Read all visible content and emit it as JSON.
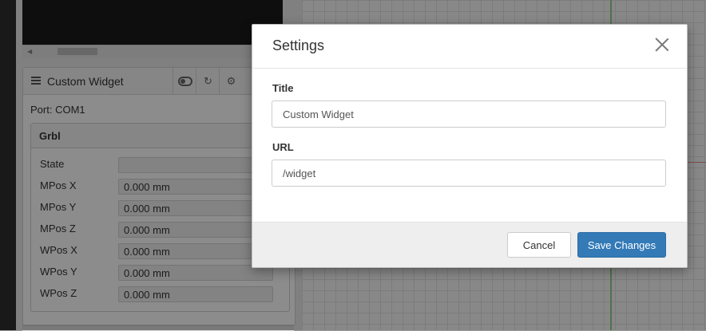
{
  "widget": {
    "title": "Custom Widget",
    "port": "Port: COM1",
    "grbl_title": "Grbl",
    "rows": [
      {
        "label": "State",
        "value": ""
      },
      {
        "label": "MPos X",
        "value": "0.000 mm"
      },
      {
        "label": "MPos Y",
        "value": "0.000 mm"
      },
      {
        "label": "MPos Z",
        "value": "0.000 mm"
      },
      {
        "label": "WPos X",
        "value": "0.000 mm"
      },
      {
        "label": "WPos Y",
        "value": "0.000 mm"
      },
      {
        "label": "WPos Z",
        "value": "0.000 mm"
      }
    ],
    "header_icons": [
      "toggle-icon",
      "refresh-icon",
      "gear-icon"
    ]
  },
  "modal": {
    "title": "Settings",
    "title_label": "Title",
    "title_value": "Custom Widget",
    "url_label": "URL",
    "url_value": "/widget",
    "cancel_label": "Cancel",
    "save_label": "Save Changes"
  },
  "colors": {
    "primary": "#337ab7",
    "overlay": "rgba(0,0,0,0.45)"
  }
}
